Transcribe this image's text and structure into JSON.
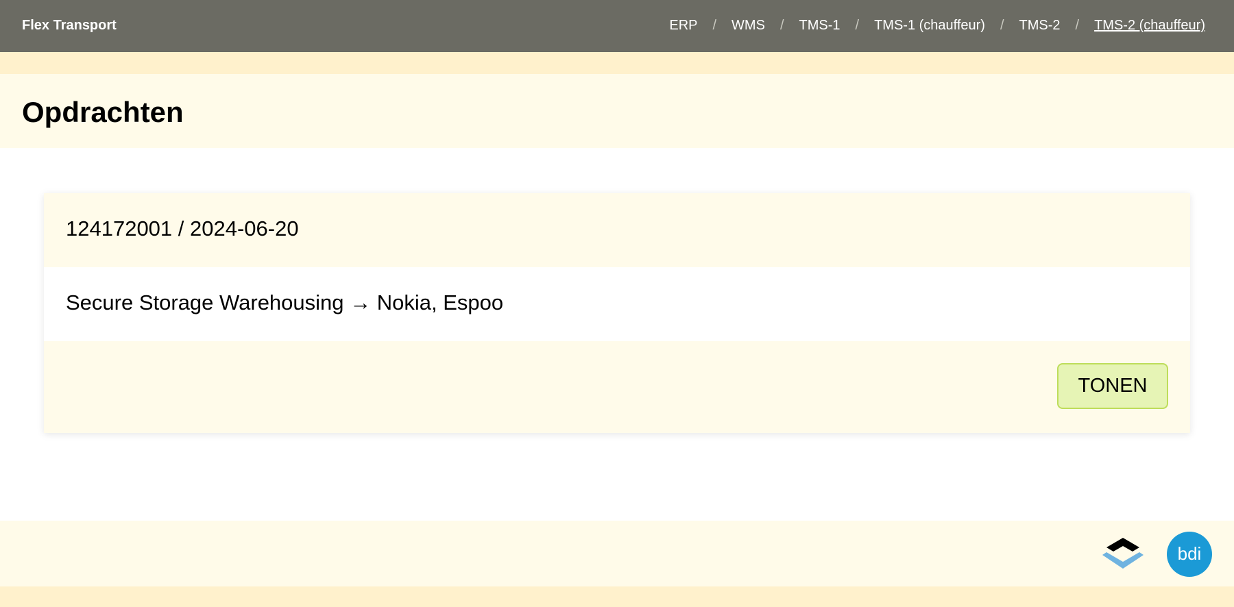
{
  "header": {
    "brand": "Flex Transport",
    "nav": [
      {
        "label": "ERP"
      },
      {
        "label": "WMS"
      },
      {
        "label": "TMS-1"
      },
      {
        "label": "TMS-1 (chauffeur)"
      },
      {
        "label": "TMS-2"
      },
      {
        "label": "TMS-2 (chauffeur)",
        "active": true
      }
    ],
    "separator": "/"
  },
  "page": {
    "title": "Opdrachten"
  },
  "order_card": {
    "header": "124172001 / 2024-06-20",
    "route": "Secure Storage Warehousing → Nokia, Espoo",
    "show_button_label": "TONEN"
  },
  "footer": {
    "logos": [
      "layers-logo-icon",
      "bdi-logo-icon"
    ],
    "bdi_logo_text": "bdi"
  },
  "colors": {
    "topbar": "#6b6b63",
    "accent_strip": "#fff1cc",
    "band": "#fffbe9",
    "button_bg": "#e6f4b5",
    "button_border": "#bedd5a",
    "bdi_blue": "#1b9ad6",
    "layers_dark": "#000000",
    "layers_light": "#6fb3e0"
  }
}
